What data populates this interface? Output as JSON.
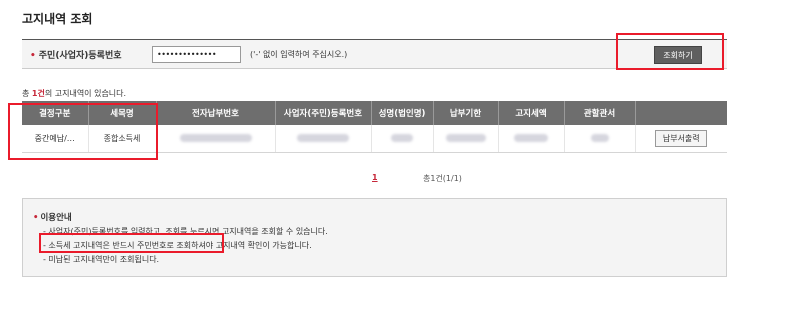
{
  "page": {
    "title": "고지내역 조회"
  },
  "search": {
    "label": "주민(사업자)등록번호",
    "bullet": "•",
    "value": "••••••••••••••",
    "hint": "('-' 없이 입력하여 주십시오.)",
    "button_label": "조회하기"
  },
  "result": {
    "prefix": "총 ",
    "count": "1건",
    "suffix": "의 고지내역이 있습니다."
  },
  "table": {
    "headers": [
      "결정구분",
      "세목명",
      "전자납부번호",
      "사업자(주민)등록번호",
      "성명(법인명)",
      "납부기한",
      "고지세액",
      "관할관서",
      ""
    ],
    "rows": [
      {
        "decision": "중간예납/…",
        "tax_item": "종합소득세",
        "pay_button": "납부서출력"
      }
    ]
  },
  "pagination": {
    "current": "1",
    "total": "총1건(1/1)"
  },
  "info": {
    "title": "이용안내",
    "bullet": "•",
    "lines": [
      "- 사업자(주민)등록번호를 입력하고, 조회를 누르시면 고지내역을 조회할 수 있습니다.",
      "- 소득세 고지내역은 반드시 주민번호로 조회하셔야 고지내역 확인이 가능합니다.",
      "- 미납된 고지내역만이 조회됩니다."
    ]
  },
  "colors": {
    "highlight": "#ea1b2b",
    "accent": "#c6283a",
    "header_bg": "#6e6e6e"
  }
}
